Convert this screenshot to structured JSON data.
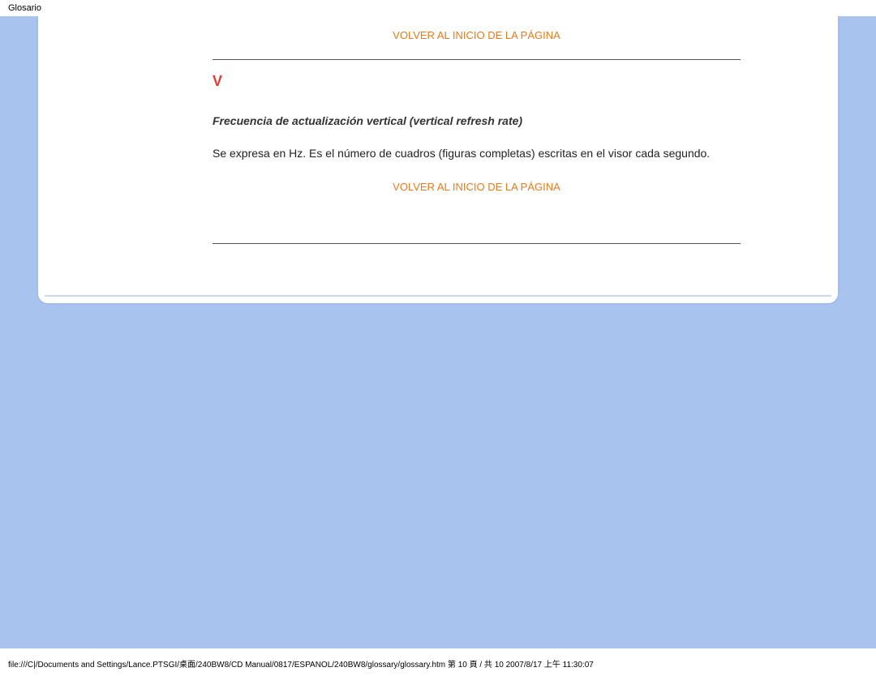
{
  "header": {
    "title": "Glosario"
  },
  "links": {
    "back_to_top": "VOLVER AL INICIO DE LA PÁGINA"
  },
  "section": {
    "letter": "V",
    "term_title": "Frecuencia de actualización vertical (vertical refresh rate)",
    "term_body": "Se expresa en Hz. Es el número de cuadros (figuras completas) escritas en el visor cada segundo."
  },
  "footer": {
    "path": "file:///C|/Documents and Settings/Lance.PTSGI/桌面/240BW8/CD Manual/0817/ESPANOL/240BW8/glossary/glossary.htm 第 10 頁 / 共 10 2007/8/17 上午 11:30:07"
  }
}
